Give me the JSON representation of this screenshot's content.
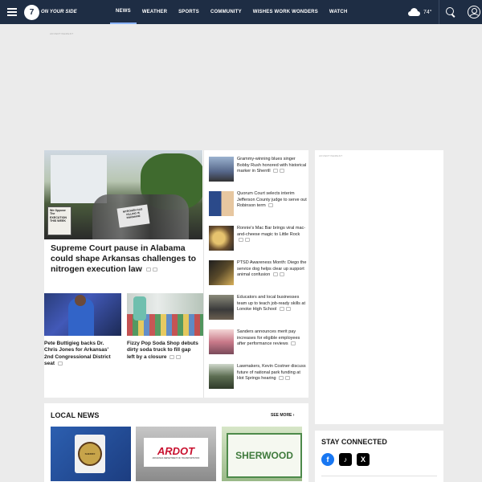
{
  "header": {
    "logo_number": "7",
    "logo_tagline": "ON YOUR SIDE",
    "nav": [
      "NEWS",
      "WEATHER",
      "SPORTS",
      "COMMUNITY",
      "WISHES WORK WONDERS",
      "WATCH"
    ],
    "weather_icon": "partly-cloudy-icon",
    "temperature": "74°"
  },
  "ads": {
    "label": "ADVERTISEMENT"
  },
  "hero": {
    "image_signs": [
      "We Oppose The EXECUTION THIS WEEK",
      "NITROGEN GAS KILLING IS INHUMANE"
    ],
    "title": "Supreme Court pause in Alabama could shape Arkansas challenges to nitrogen execution law"
  },
  "sub_stories": [
    {
      "title": "Pete Buttigieg backs Dr. Chris Jones for Arkansas' 2nd Congressional District seat"
    },
    {
      "title": "Fizzy Pop Soda Shop debuts dirty soda truck to fill gap left by a closure"
    }
  ],
  "side_stories": [
    {
      "title": "Grammy-winning blues singer Bobby Rush honored with historical marker in Sherrill"
    },
    {
      "title": "Quorum Court selects interim Jefferson County judge to serve out Robinson term"
    },
    {
      "title": "Ronnie's Mac Bar brings viral mac-and-cheese magic to Little Rock"
    },
    {
      "title": "PTSD Awareness Month: Diego the service dog helps clear up support animal confusion"
    },
    {
      "title": "Educators and local businesses team up to teach job-ready skills at Lonoke High School"
    },
    {
      "title": "Sanders announces merit pay increases for eligible employees after performance reviews"
    },
    {
      "title": "Lawmakers, Kevin Costner discuss future of national park funding at Hot Springs hearing"
    }
  ],
  "local_news": {
    "title": "LOCAL NEWS",
    "see_more": "SEE MORE",
    "cards": [
      {
        "image_text": "SHERIFF"
      },
      {
        "image_text": "ARDOT",
        "image_subtext": "ARKANSAS DEPARTMENT OF TRANSPORTATION"
      },
      {
        "image_text": "SHERWOOD"
      }
    ]
  },
  "stay_connected": {
    "title": "STAY CONNECTED",
    "icons": [
      "facebook-icon",
      "tiktok-icon",
      "x-icon"
    ]
  }
}
